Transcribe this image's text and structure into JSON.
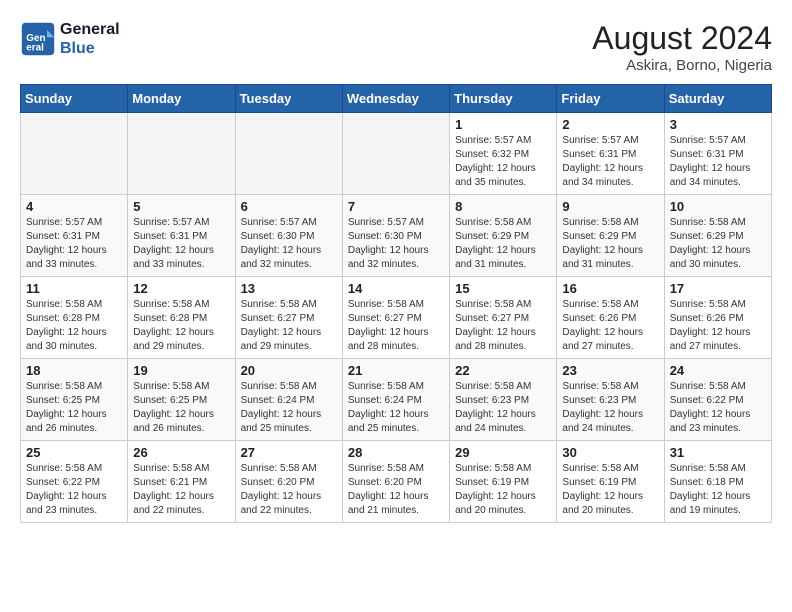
{
  "logo": {
    "line1": "General",
    "line2": "Blue"
  },
  "title": "August 2024",
  "location": "Askira, Borno, Nigeria",
  "days_of_week": [
    "Sunday",
    "Monday",
    "Tuesday",
    "Wednesday",
    "Thursday",
    "Friday",
    "Saturday"
  ],
  "weeks": [
    [
      {
        "day": "",
        "info": ""
      },
      {
        "day": "",
        "info": ""
      },
      {
        "day": "",
        "info": ""
      },
      {
        "day": "",
        "info": ""
      },
      {
        "day": "1",
        "info": "Sunrise: 5:57 AM\nSunset: 6:32 PM\nDaylight: 12 hours\nand 35 minutes."
      },
      {
        "day": "2",
        "info": "Sunrise: 5:57 AM\nSunset: 6:31 PM\nDaylight: 12 hours\nand 34 minutes."
      },
      {
        "day": "3",
        "info": "Sunrise: 5:57 AM\nSunset: 6:31 PM\nDaylight: 12 hours\nand 34 minutes."
      }
    ],
    [
      {
        "day": "4",
        "info": "Sunrise: 5:57 AM\nSunset: 6:31 PM\nDaylight: 12 hours\nand 33 minutes."
      },
      {
        "day": "5",
        "info": "Sunrise: 5:57 AM\nSunset: 6:31 PM\nDaylight: 12 hours\nand 33 minutes."
      },
      {
        "day": "6",
        "info": "Sunrise: 5:57 AM\nSunset: 6:30 PM\nDaylight: 12 hours\nand 32 minutes."
      },
      {
        "day": "7",
        "info": "Sunrise: 5:57 AM\nSunset: 6:30 PM\nDaylight: 12 hours\nand 32 minutes."
      },
      {
        "day": "8",
        "info": "Sunrise: 5:58 AM\nSunset: 6:29 PM\nDaylight: 12 hours\nand 31 minutes."
      },
      {
        "day": "9",
        "info": "Sunrise: 5:58 AM\nSunset: 6:29 PM\nDaylight: 12 hours\nand 31 minutes."
      },
      {
        "day": "10",
        "info": "Sunrise: 5:58 AM\nSunset: 6:29 PM\nDaylight: 12 hours\nand 30 minutes."
      }
    ],
    [
      {
        "day": "11",
        "info": "Sunrise: 5:58 AM\nSunset: 6:28 PM\nDaylight: 12 hours\nand 30 minutes."
      },
      {
        "day": "12",
        "info": "Sunrise: 5:58 AM\nSunset: 6:28 PM\nDaylight: 12 hours\nand 29 minutes."
      },
      {
        "day": "13",
        "info": "Sunrise: 5:58 AM\nSunset: 6:27 PM\nDaylight: 12 hours\nand 29 minutes."
      },
      {
        "day": "14",
        "info": "Sunrise: 5:58 AM\nSunset: 6:27 PM\nDaylight: 12 hours\nand 28 minutes."
      },
      {
        "day": "15",
        "info": "Sunrise: 5:58 AM\nSunset: 6:27 PM\nDaylight: 12 hours\nand 28 minutes."
      },
      {
        "day": "16",
        "info": "Sunrise: 5:58 AM\nSunset: 6:26 PM\nDaylight: 12 hours\nand 27 minutes."
      },
      {
        "day": "17",
        "info": "Sunrise: 5:58 AM\nSunset: 6:26 PM\nDaylight: 12 hours\nand 27 minutes."
      }
    ],
    [
      {
        "day": "18",
        "info": "Sunrise: 5:58 AM\nSunset: 6:25 PM\nDaylight: 12 hours\nand 26 minutes."
      },
      {
        "day": "19",
        "info": "Sunrise: 5:58 AM\nSunset: 6:25 PM\nDaylight: 12 hours\nand 26 minutes."
      },
      {
        "day": "20",
        "info": "Sunrise: 5:58 AM\nSunset: 6:24 PM\nDaylight: 12 hours\nand 25 minutes."
      },
      {
        "day": "21",
        "info": "Sunrise: 5:58 AM\nSunset: 6:24 PM\nDaylight: 12 hours\nand 25 minutes."
      },
      {
        "day": "22",
        "info": "Sunrise: 5:58 AM\nSunset: 6:23 PM\nDaylight: 12 hours\nand 24 minutes."
      },
      {
        "day": "23",
        "info": "Sunrise: 5:58 AM\nSunset: 6:23 PM\nDaylight: 12 hours\nand 24 minutes."
      },
      {
        "day": "24",
        "info": "Sunrise: 5:58 AM\nSunset: 6:22 PM\nDaylight: 12 hours\nand 23 minutes."
      }
    ],
    [
      {
        "day": "25",
        "info": "Sunrise: 5:58 AM\nSunset: 6:22 PM\nDaylight: 12 hours\nand 23 minutes."
      },
      {
        "day": "26",
        "info": "Sunrise: 5:58 AM\nSunset: 6:21 PM\nDaylight: 12 hours\nand 22 minutes."
      },
      {
        "day": "27",
        "info": "Sunrise: 5:58 AM\nSunset: 6:20 PM\nDaylight: 12 hours\nand 22 minutes."
      },
      {
        "day": "28",
        "info": "Sunrise: 5:58 AM\nSunset: 6:20 PM\nDaylight: 12 hours\nand 21 minutes."
      },
      {
        "day": "29",
        "info": "Sunrise: 5:58 AM\nSunset: 6:19 PM\nDaylight: 12 hours\nand 20 minutes."
      },
      {
        "day": "30",
        "info": "Sunrise: 5:58 AM\nSunset: 6:19 PM\nDaylight: 12 hours\nand 20 minutes."
      },
      {
        "day": "31",
        "info": "Sunrise: 5:58 AM\nSunset: 6:18 PM\nDaylight: 12 hours\nand 19 minutes."
      }
    ]
  ]
}
